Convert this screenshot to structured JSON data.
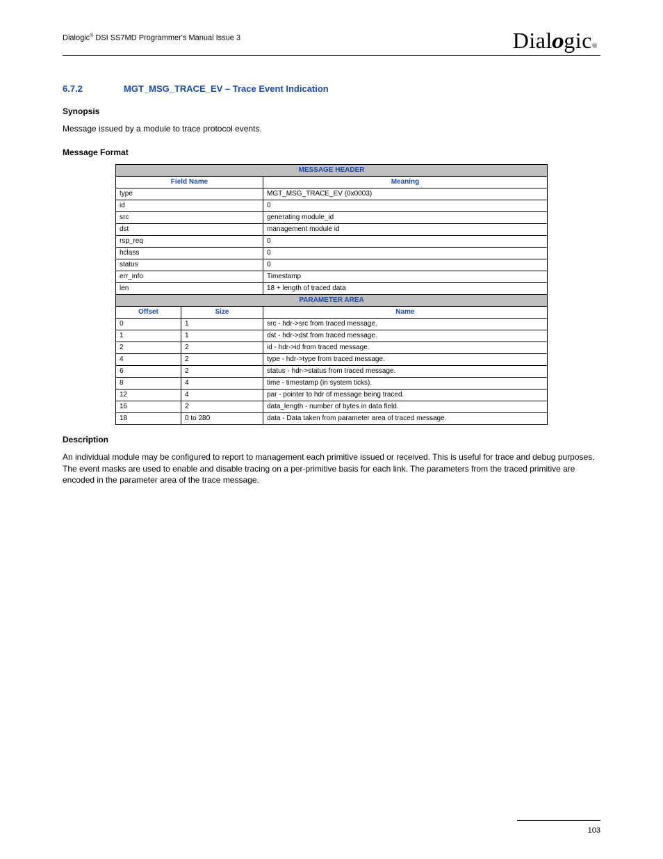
{
  "header": {
    "left_prefix": "Dialogic",
    "left_suffix": " DSI SS7MD Programmer's Manual  Issue 3",
    "logo_text": "Dialogic"
  },
  "section": {
    "number": "6.7.2",
    "title": "MGT_MSG_TRACE_EV – Trace Event Indication"
  },
  "synopsis": {
    "heading": "Synopsis",
    "text": "Message issued by a module to trace protocol events."
  },
  "message_format": {
    "heading": "Message Format",
    "table1_title": "MESSAGE HEADER",
    "col_field": "Field Name",
    "col_meaning": "Meaning",
    "rows": [
      {
        "field": "type",
        "meaning": "MGT_MSG_TRACE_EV (0x0003)"
      },
      {
        "field": "id",
        "meaning": "0"
      },
      {
        "field": "src",
        "meaning": "generating module_id"
      },
      {
        "field": "dst",
        "meaning": "management module id"
      },
      {
        "field": "rsp_req",
        "meaning": "0"
      },
      {
        "field": "hclass",
        "meaning": "0"
      },
      {
        "field": "status",
        "meaning": "0"
      },
      {
        "field": "err_info",
        "meaning": "Timestamp"
      },
      {
        "field": "len",
        "meaning": "18 + length of traced data"
      }
    ],
    "table2_title": "PARAMETER AREA",
    "col_offset": "Offset",
    "col_size": "Size",
    "col_name": "Name",
    "params": [
      {
        "offset": "0",
        "size": "1",
        "name": "src - hdr->src from traced message."
      },
      {
        "offset": "1",
        "size": "1",
        "name": "dst - hdr->dst from traced message."
      },
      {
        "offset": "2",
        "size": "2",
        "name": "id - hdr->id from traced message."
      },
      {
        "offset": "4",
        "size": "2",
        "name": "type - hdr->type from traced message."
      },
      {
        "offset": "6",
        "size": "2",
        "name": "status - hdr->status from traced message."
      },
      {
        "offset": "8",
        "size": "4",
        "name": "time - timestamp (in system ticks)."
      },
      {
        "offset": "12",
        "size": "4",
        "name": "par - pointer to hdr of message being traced."
      },
      {
        "offset": "16",
        "size": "2",
        "name": "data_length - number of bytes in data field."
      },
      {
        "offset": "18",
        "size": "0 to 280",
        "name": "data - Data taken from parameter area of traced message."
      }
    ]
  },
  "description": {
    "heading": "Description",
    "text": "An individual module may be configured to report to management each primitive issued or received. This is useful for trace and debug purposes. The event masks are used to enable and disable tracing on a per-primitive basis for each link. The parameters from the traced primitive are encoded in the parameter area of the trace message."
  },
  "page_number": "103"
}
